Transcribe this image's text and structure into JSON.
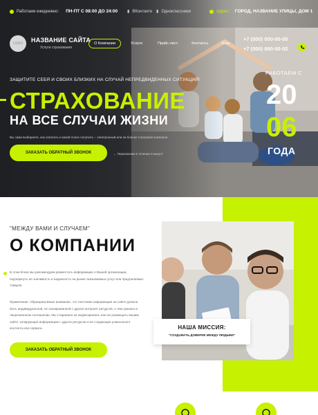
{
  "topbar": {
    "hours_label": "Работаем ежедневно:",
    "hours_value": "ПН-ПТ С 08:00 ДО 24:00",
    "link1": "ВКонтакте",
    "link2": "Одноклассники",
    "address_label": "Адрес:",
    "address_value": "ГОРОД, НАЗВАНИЕ УЛИЦЫ, ДОМ 1"
  },
  "header": {
    "logo_text": "LOGO",
    "site_name": "НАЗВАНИЕ САЙТА",
    "site_subtitle": "Услуги страхования",
    "nav": [
      "О Компании",
      "Услуги",
      "Прайс-лист",
      "Контакты",
      "Блог"
    ],
    "phones": [
      "+7 (000) 000-00-00",
      "+7 (000) 000-00-02"
    ]
  },
  "hero": {
    "tagline": "ЗАЩИТИТЕ СЕБЯ И СВОИХ БЛИЗКИХ НА СЛУЧАЙ НЕПРЕДВИДЕННЫХ СИТУАЦИЙ!",
    "title_line1": "СТРАХОВАНИЕ",
    "title_line2": "НА ВСЕ СЛУЧАИ ЖИЗНИ",
    "note": "Вы сами выбираете, как оплатить и какой полис получить – электронный или на бланке страховой компании",
    "button": "ЗАКАЗАТЬ ОБРАТНЫЙ ЗВОНОК",
    "button_note": "Перезвоним в течение 5 минут!",
    "years_label": "РАБОТАЕМ С",
    "years_1": "20",
    "years_2": "06",
    "years_word": "ГОДА"
  },
  "about": {
    "quote": "\"МЕЖДУ ВАМИ И СЛУЧАЕМ\"",
    "title": "О КОМПАНИИ",
    "paragraph1": "В этом блоке мы рекомендуем разместить информацию о Вашей организации, подчеркнуть ее значимость и надежность на рынке оказываемых услуг или предлагаемых товаров.",
    "paragraph2": "Примечание. Обращаем Ваше внимание, что текстовая информация на сайте должна быть индивидуальной, не скопированной с других интернет ресурсов, о чем указано в лицензионном соглашении. Мы стараемся не индексировать или не размещать вашим сайте, копирующие информацию с других ресурсов и не создающие уникального контента или сервиса.",
    "button": "ЗАКАЗАТЬ ОБРАТНЫЙ ЗВОНОК",
    "mission_title": "НАША МИССИЯ:",
    "mission_text": "\"СОЗДАВАТЬ ДОВЕРИЕ МЕЖДУ ЛЮДЬМИ\""
  },
  "colors": {
    "accent": "#c6f100",
    "dark": "#2a2b2e"
  }
}
